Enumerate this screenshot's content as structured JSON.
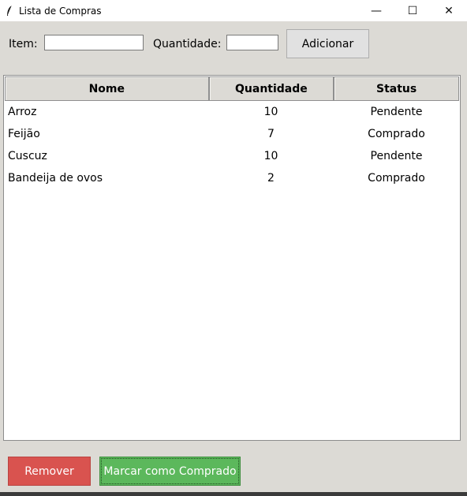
{
  "window": {
    "title": "Lista de Compras",
    "icon": "feather-icon",
    "controls": {
      "minimize": "—",
      "maximize": "☐",
      "close": "✕"
    }
  },
  "form": {
    "item_label": "Item:",
    "item_value": "",
    "quantity_label": "Quantidade:",
    "quantity_value": "",
    "add_button": "Adicionar"
  },
  "table": {
    "columns": [
      "Nome",
      "Quantidade",
      "Status"
    ],
    "rows": [
      {
        "nome": "Arroz",
        "quantidade": "10",
        "status": "Pendente"
      },
      {
        "nome": "Feijão",
        "quantidade": "7",
        "status": "Comprado"
      },
      {
        "nome": "Cuscuz",
        "quantidade": "10",
        "status": "Pendente"
      },
      {
        "nome": "Bandeija de ovos",
        "quantidade": "2",
        "status": "Comprado"
      }
    ]
  },
  "actions": {
    "remove_button": "Remover",
    "remove_color": "#d9534f",
    "mark_button": "Marcar como Comprado",
    "mark_color": "#5cb85c"
  }
}
